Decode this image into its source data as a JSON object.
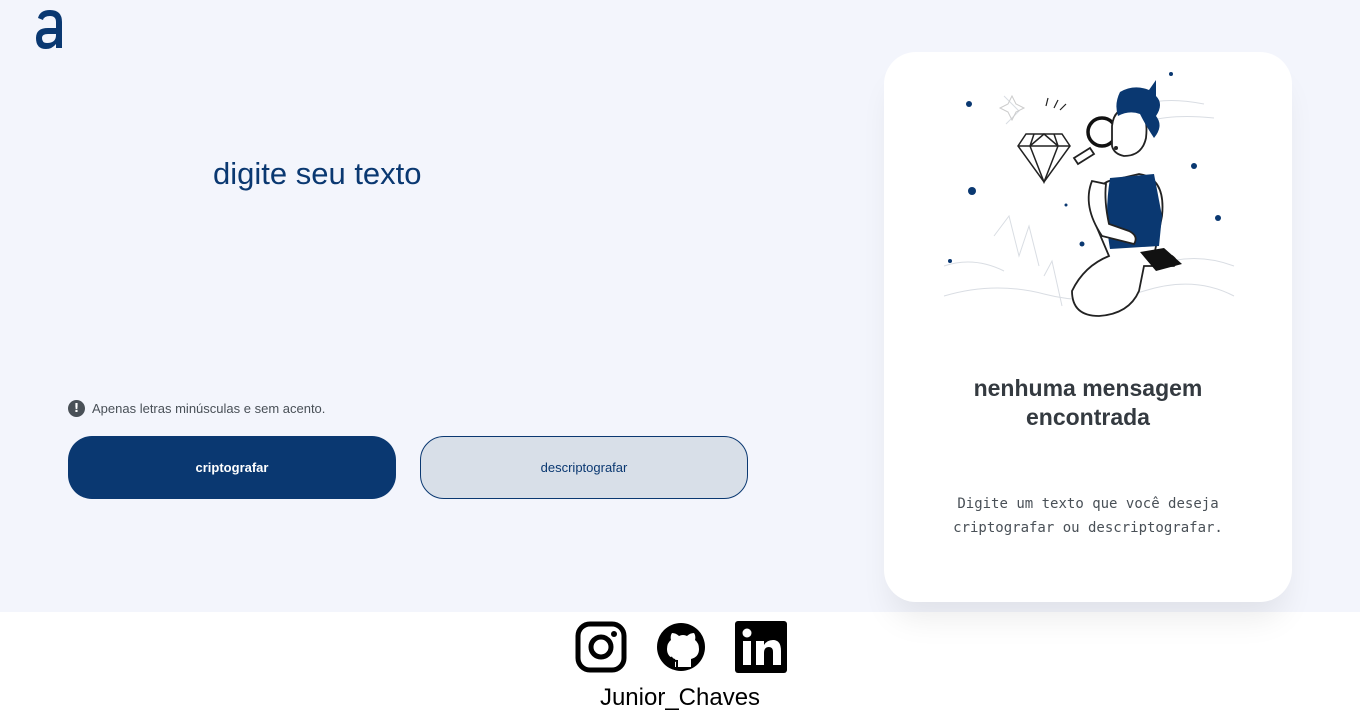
{
  "brand": {
    "logo_icon": "alura-a-logo-icon",
    "accent": "#0a3871"
  },
  "input": {
    "placeholder": "digite seu texto",
    "value": ""
  },
  "hint": {
    "icon": "exclamation-circle-icon",
    "text": "Apenas letras minúsculas e sem acento."
  },
  "buttons": {
    "encrypt_label": "criptografar",
    "decrypt_label": "descriptografar"
  },
  "output": {
    "illustration": "person-with-magnifying-glass-illustration",
    "title": "nenhuma mensagem encontrada",
    "text": "Digite um texto que você deseja criptografar ou descriptografar."
  },
  "footer": {
    "icons": [
      "instagram-icon",
      "github-icon",
      "linkedin-icon"
    ],
    "name": "Junior_Chaves"
  }
}
